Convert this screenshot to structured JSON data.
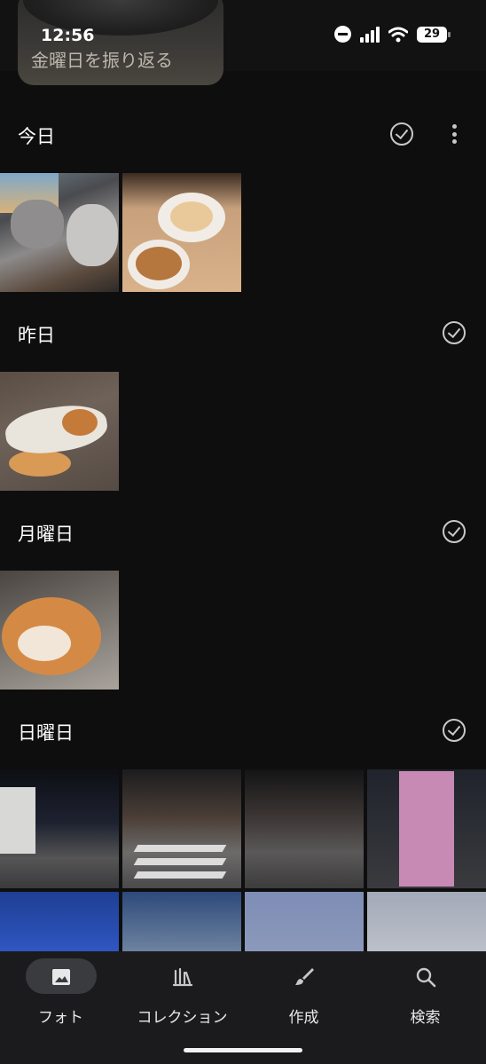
{
  "status_bar": {
    "time": "12:56",
    "battery": "29"
  },
  "memory": {
    "title": "金曜日を振り返る"
  },
  "sections": [
    {
      "title": "今日",
      "photo_count": 2,
      "has_more_menu": true
    },
    {
      "title": "昨日",
      "photo_count": 1
    },
    {
      "title": "月曜日",
      "photo_count": 1
    },
    {
      "title": "日曜日",
      "photo_count": 8
    }
  ],
  "photo_subjects": {
    "today": [
      "cats-on-desk",
      "ramen-bowls"
    ],
    "yesterday": [
      "sleeping-cat"
    ],
    "monday": [
      "curled-cat"
    ],
    "sunday": [
      "night-street",
      "night-crosswalk",
      "night-intersection",
      "pink-signboard",
      "blue-stage",
      "building-screen",
      "cloudy-sky",
      "outdoor-stage"
    ]
  },
  "bottom_nav": {
    "items": [
      {
        "label": "フォト",
        "icon": "photo-icon",
        "selected": true
      },
      {
        "label": "コレクション",
        "icon": "library-icon",
        "selected": false
      },
      {
        "label": "作成",
        "icon": "brush-icon",
        "selected": false
      },
      {
        "label": "検索",
        "icon": "search-icon",
        "selected": false
      }
    ]
  },
  "colors": {
    "background": "#0e0e0e",
    "nav_background": "#1b1b1d",
    "selected_pill": "#3a3b3e",
    "icon_gray": "#c8c8c8"
  }
}
